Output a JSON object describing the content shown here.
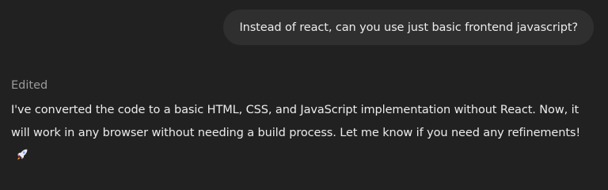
{
  "user_message": {
    "text": "Instead of react, can you use just basic frontend javascript?"
  },
  "assistant_message": {
    "status": "Edited",
    "text": "I've converted the code to a basic HTML, CSS, and JavaScript implementation without React. Now, it will work in any browser without needing a build process. Let me know if you need any refinements!",
    "emoji_icon": "rocket-icon"
  },
  "colors": {
    "background": "#212121",
    "user_bubble": "#2f2f2f",
    "text": "#ececec",
    "muted_text": "#9b9b9b"
  }
}
